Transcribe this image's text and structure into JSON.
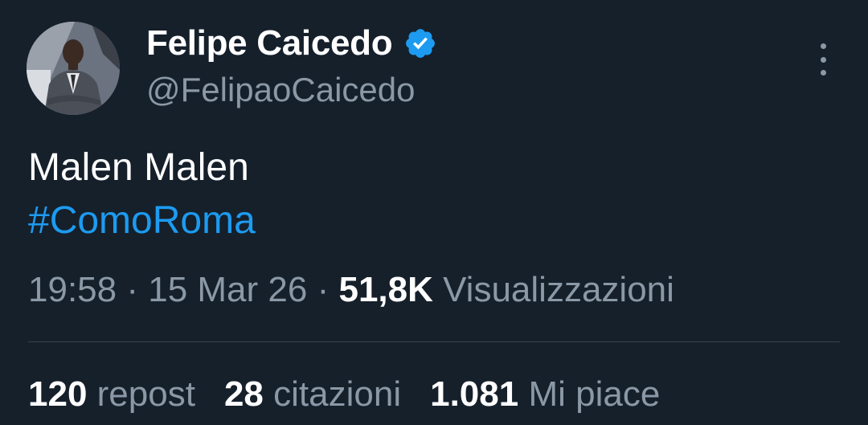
{
  "author": {
    "display_name": "Felipe Caicedo",
    "handle": "@FelipaoCaicedo",
    "verified": true
  },
  "tweet": {
    "text_line1": "Malen Malen",
    "hashtag": "#ComoRoma",
    "time": "19:58",
    "date": "15 Mar 26",
    "separator": "·",
    "views_count": "51,8K",
    "views_label": "Visualizzazioni"
  },
  "stats": {
    "reposts_count": "120",
    "reposts_label": "repost",
    "quotes_count": "28",
    "quotes_label": "citazioni",
    "likes_count": "1.081",
    "likes_label": "Mi piace"
  },
  "colors": {
    "background": "#15202b",
    "accent": "#1d9bf0",
    "secondary_text": "#8b98a5",
    "divider": "#38444d"
  },
  "icons": {
    "verified": "verified-badge-icon",
    "more": "more-options-icon"
  }
}
